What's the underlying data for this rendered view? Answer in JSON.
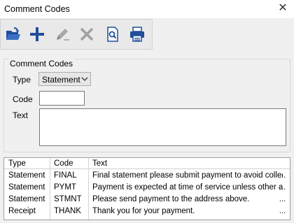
{
  "window": {
    "title": "Comment Codes",
    "close": "✕"
  },
  "toolbar": {
    "buttons": [
      {
        "name": "open-icon",
        "enabled": true
      },
      {
        "name": "add-icon",
        "enabled": true
      },
      {
        "name": "edit-icon",
        "enabled": false
      },
      {
        "name": "delete-icon",
        "enabled": false
      },
      {
        "name": "preview-icon",
        "enabled": true
      },
      {
        "name": "print-icon",
        "enabled": true
      }
    ]
  },
  "form": {
    "group_label": "Comment Codes",
    "type_label": "Type",
    "type_value": "Statement",
    "code_label": "Code",
    "code_value": "",
    "text_label": "Text",
    "text_value": ""
  },
  "grid": {
    "headers": [
      "Type",
      "Code",
      "Text"
    ],
    "rows": [
      {
        "type": "Statement",
        "code": "FINAL",
        "text": "Final statement please submit payment to avoid collectio...",
        "more": "..."
      },
      {
        "type": "Statement",
        "code": "PYMT",
        "text": "Payment is expected at time of service unless other arran...",
        "more": "..."
      },
      {
        "type": "Statement",
        "code": "STMNT",
        "text": "Please send payment to the address above.",
        "more": "..."
      },
      {
        "type": "Receipt",
        "code": "THANK",
        "text": "Thank you for your payment.",
        "more": "..."
      }
    ]
  },
  "colors": {
    "accent": "#1f4e9b",
    "disabled": "#9a9a9a"
  }
}
